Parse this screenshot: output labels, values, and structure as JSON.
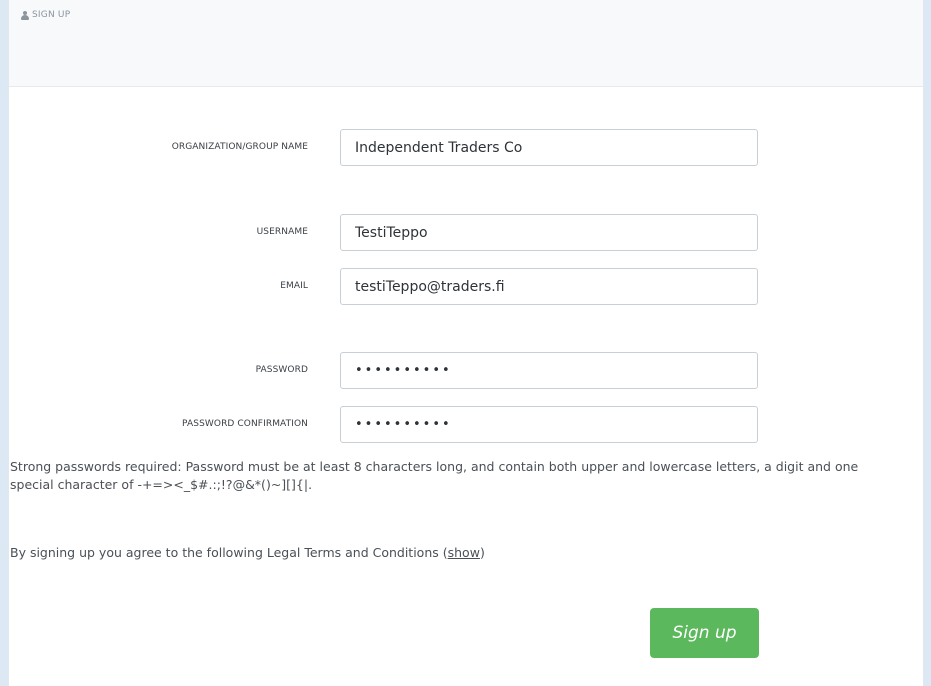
{
  "header": {
    "title": "Sign up",
    "icon": "user-icon"
  },
  "form": {
    "organization": {
      "label": "Organization/Group name",
      "value": "Independent Traders Co"
    },
    "username": {
      "label": "Username",
      "value": "TestiTeppo"
    },
    "email": {
      "label": "Email",
      "value": "testiTeppo@traders.fi"
    },
    "password": {
      "label": "Password",
      "value": "••••••••••"
    },
    "password_confirmation": {
      "label": "Password confirmation",
      "value": "••••••••••"
    }
  },
  "password_hint": "Strong passwords required: Password must be at least 8 characters long, and contain both upper and lowercase letters, a digit and one special character of -+=><_$#.:;!?@&*()~][]{|.",
  "legal": {
    "text_before": "By signing up you agree to the following Legal Terms and Conditions (",
    "link_label": "show",
    "text_after": ")"
  },
  "signup_button_label": "Sign up",
  "colors": {
    "button_green": "#5cb85c",
    "page_background": "#dce9f5"
  }
}
